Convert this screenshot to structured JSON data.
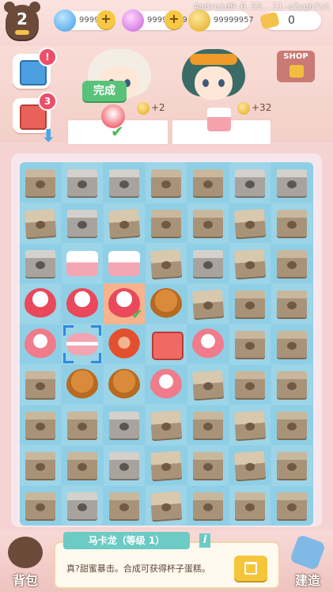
{
  "level": "2",
  "resources": {
    "diamonds": "9999986",
    "gems": "99999999",
    "coins": "99999957",
    "tickets": "0"
  },
  "debug_overlay": "Android9-6.53..11-a2yghfst",
  "side_buttons": {
    "recipe_alert": "!",
    "oven_count": "3"
  },
  "orders": {
    "done_label": "完成",
    "reward_1": "+2",
    "reward_2": "+32",
    "shop_label": "SHOP"
  },
  "board": {
    "columns": 7,
    "rows": 9,
    "cells": [
      "box",
      "grey",
      "grey",
      "box",
      "box",
      "grey",
      "grey",
      "open",
      "grey",
      "open",
      "box",
      "box",
      "open",
      "box",
      "grey",
      "cake",
      "cake",
      "open",
      "grey",
      "open",
      "box",
      "cupcake",
      "cupcake",
      "cupcake",
      "muffin",
      "open",
      "box",
      "box",
      "sparkle",
      "macaron",
      "redcake",
      "oven",
      "sparkle",
      "box",
      "box",
      "box",
      "muffin",
      "muffin",
      "sparkle",
      "open",
      "box",
      "box",
      "box",
      "box",
      "grey",
      "open",
      "box",
      "open",
      "box",
      "box",
      "box",
      "grey",
      "open",
      "box",
      "open",
      "box",
      "box",
      "grey",
      "box",
      "open",
      "box",
      "box",
      "box"
    ],
    "selected_index": 23,
    "targeted_index": 29
  },
  "info": {
    "title": "马卡龙（等级 1）",
    "description": "真?甜蜜暴击。合成可获得杯子蛋糕。"
  },
  "bottom": {
    "bag_label": "背包",
    "build_label": "建造"
  }
}
